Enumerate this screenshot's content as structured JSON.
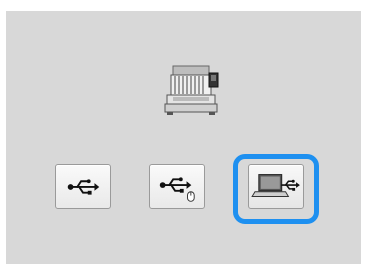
{
  "screen": {
    "icons": {
      "machine": "embroidery-machine-icon",
      "usb": "usb-icon",
      "usb_mouse": "usb-mouse-icon",
      "computer_usb": "computer-usb-icon"
    },
    "selected_option": "computer_usb",
    "colors": {
      "panel_bg": "#d8d8d8",
      "selection_ring": "#1e90f0"
    }
  }
}
